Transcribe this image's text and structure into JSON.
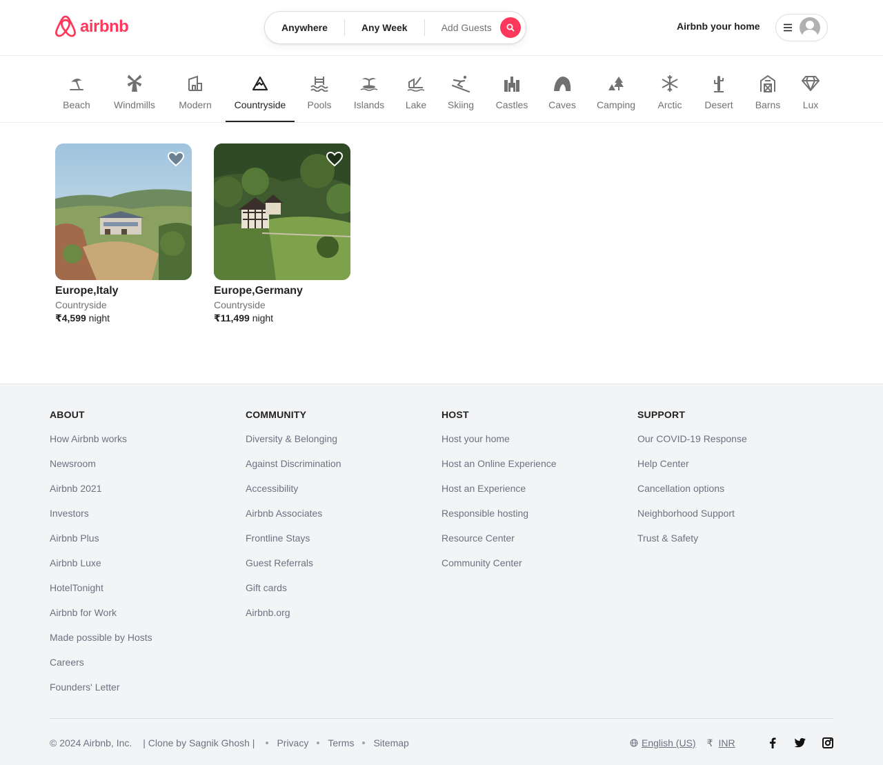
{
  "header": {
    "logo_text": "airbnb",
    "search": {
      "anywhere": "Anywhere",
      "any_week": "Any Week",
      "add_guests": "Add Guests"
    },
    "host_link": "Airbnb your home"
  },
  "categories": [
    {
      "label": "Beach",
      "icon": "beach-icon"
    },
    {
      "label": "Windmills",
      "icon": "windmill-icon"
    },
    {
      "label": "Modern",
      "icon": "modern-icon"
    },
    {
      "label": "Countryside",
      "icon": "countryside-icon",
      "active": true
    },
    {
      "label": "Pools",
      "icon": "pool-icon"
    },
    {
      "label": "Islands",
      "icon": "island-icon"
    },
    {
      "label": "Lake",
      "icon": "lake-icon"
    },
    {
      "label": "Skiing",
      "icon": "skiing-icon"
    },
    {
      "label": "Castles",
      "icon": "castle-icon"
    },
    {
      "label": "Caves",
      "icon": "cave-icon"
    },
    {
      "label": "Camping",
      "icon": "camping-icon"
    },
    {
      "label": "Arctic",
      "icon": "arctic-icon"
    },
    {
      "label": "Desert",
      "icon": "desert-icon"
    },
    {
      "label": "Barns",
      "icon": "barn-icon"
    },
    {
      "label": "Lux",
      "icon": "lux-icon"
    }
  ],
  "listings": [
    {
      "location": "Europe,Italy",
      "type": "Countryside",
      "price": "₹4,599",
      "unit": "night"
    },
    {
      "location": "Europe,Germany",
      "type": "Countryside",
      "price": "₹11,499",
      "unit": "night"
    }
  ],
  "footer": {
    "about": {
      "title": "ABOUT",
      "links": [
        "How Airbnb works",
        "Newsroom",
        "Airbnb 2021",
        "Investors",
        "Airbnb Plus",
        "Airbnb Luxe",
        "HotelTonight",
        "Airbnb for Work",
        "Made possible by Hosts",
        "Careers",
        "Founders' Letter"
      ]
    },
    "community": {
      "title": "COMMUNITY",
      "links": [
        "Diversity & Belonging",
        "Against Discrimination",
        "Accessibility",
        "Airbnb Associates",
        "Frontline Stays",
        "Guest Referrals",
        "Gift cards",
        "Airbnb.org"
      ]
    },
    "host": {
      "title": "HOST",
      "links": [
        "Host your home",
        "Host an Online Experience",
        "Host an Experience",
        "Responsible hosting",
        "Resource Center",
        "Community Center"
      ]
    },
    "support": {
      "title": "SUPPORT",
      "links": [
        "Our COVID-19 Response",
        "Help Center",
        "Cancellation options",
        "Neighborhood Support",
        "Trust & Safety"
      ]
    },
    "bottom": {
      "copyright": "© 2024 Airbnb, Inc.",
      "clone": "| Clone by Sagnik Ghosh |",
      "privacy": "Privacy",
      "terms": "Terms",
      "sitemap": "Sitemap",
      "language": "English (US)",
      "currency_symbol": "₹",
      "currency": "INR"
    }
  },
  "colors": {
    "brand": "#ff385c",
    "footer_bg": "#f3f4f6"
  }
}
